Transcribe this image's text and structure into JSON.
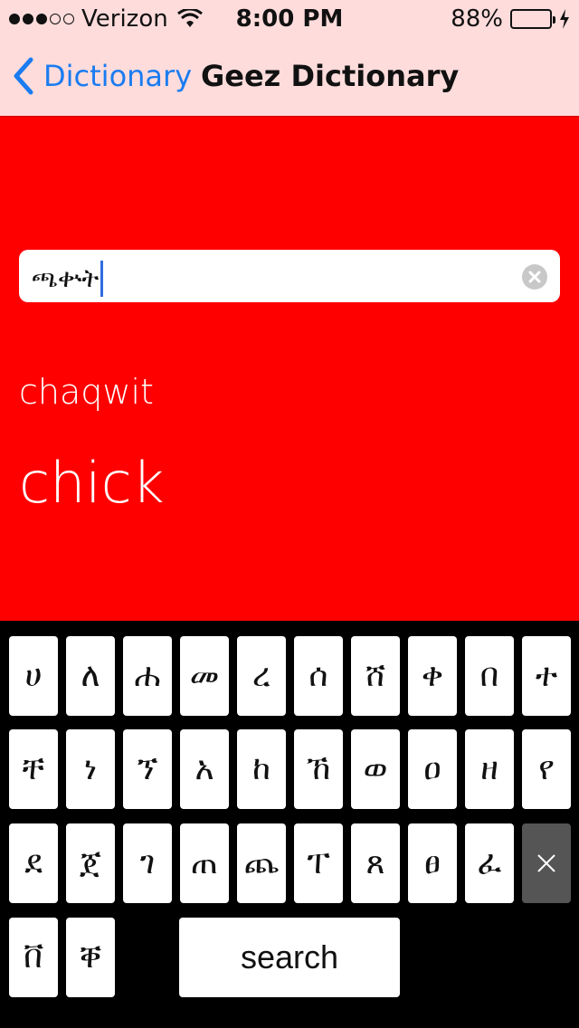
{
  "status": {
    "carrier": "Verizon",
    "time": "8:00 PM",
    "battery": "88%",
    "battery_level": 0.88
  },
  "nav": {
    "back_label": "Dictionary",
    "title": "Geez Dictionary"
  },
  "search": {
    "value": "ጫቍት"
  },
  "result": {
    "transliteration": "chaqwit",
    "meaning": "chick"
  },
  "keyboard": {
    "row1": [
      "ሀ",
      "ለ",
      "ሐ",
      "መ",
      "ረ",
      "ሰ",
      "ሸ",
      "ቀ",
      "በ",
      "ተ"
    ],
    "row2": [
      "ቸ",
      "ነ",
      "ኘ",
      "አ",
      "ከ",
      "ኸ",
      "ወ",
      "ዐ",
      "ዘ",
      "የ"
    ],
    "row3": [
      "ደ",
      "ጀ",
      "ገ",
      "ጠ",
      "ጨ",
      "ፐ",
      "ጸ",
      "ፀ",
      "ፈ"
    ],
    "row4": [
      "ቨ",
      "ቐ"
    ],
    "search_label": "search"
  },
  "colors": {
    "accent": "#1a7cf0",
    "background": "#ff0000",
    "header": "#ffdcdc"
  }
}
